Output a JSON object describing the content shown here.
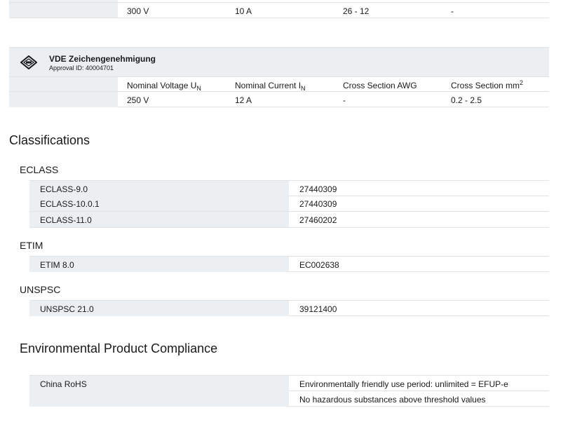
{
  "prev_table": {
    "row": {
      "voltage": "300 V",
      "current": "10 A",
      "awg": "26 - 12",
      "mm2": "-"
    }
  },
  "vde": {
    "icon": "vde-approval-mark-icon",
    "title": "VDE Zeichengenehmigung",
    "approval_id": "Approval ID: 40004701",
    "headers": {
      "voltage": "Nominal Voltage U",
      "voltage_sub": "N",
      "current": "Nominal Current I",
      "current_sub": "N",
      "awg": "Cross Section AWG",
      "mm2": "Cross Section mm",
      "mm2_sup": "2"
    },
    "row": {
      "voltage": "250 V",
      "current": "12 A",
      "awg": "-",
      "mm2": "0.2 - 2.5"
    }
  },
  "classifications": {
    "title": "Classifications",
    "eclass": {
      "title": "ECLASS",
      "rows": [
        {
          "label": "ECLASS-9.0",
          "value": "27440309"
        },
        {
          "label": "ECLASS-10.0.1",
          "value": "27440309"
        },
        {
          "label": "ECLASS-11.0",
          "value": "27460202"
        }
      ]
    },
    "etim": {
      "title": "ETIM",
      "rows": [
        {
          "label": "ETIM 8.0",
          "value": "EC002638"
        }
      ]
    },
    "unspsc": {
      "title": "UNSPSC",
      "rows": [
        {
          "label": "UNSPSC 21.0",
          "value": "39121400"
        }
      ]
    }
  },
  "environmental": {
    "title": "Environmental Product Compliance",
    "label": "China RoHS",
    "values": [
      "Environmentally friendly use period: unlimited = EFUP-e",
      "No hazardous substances above threshold values"
    ]
  }
}
